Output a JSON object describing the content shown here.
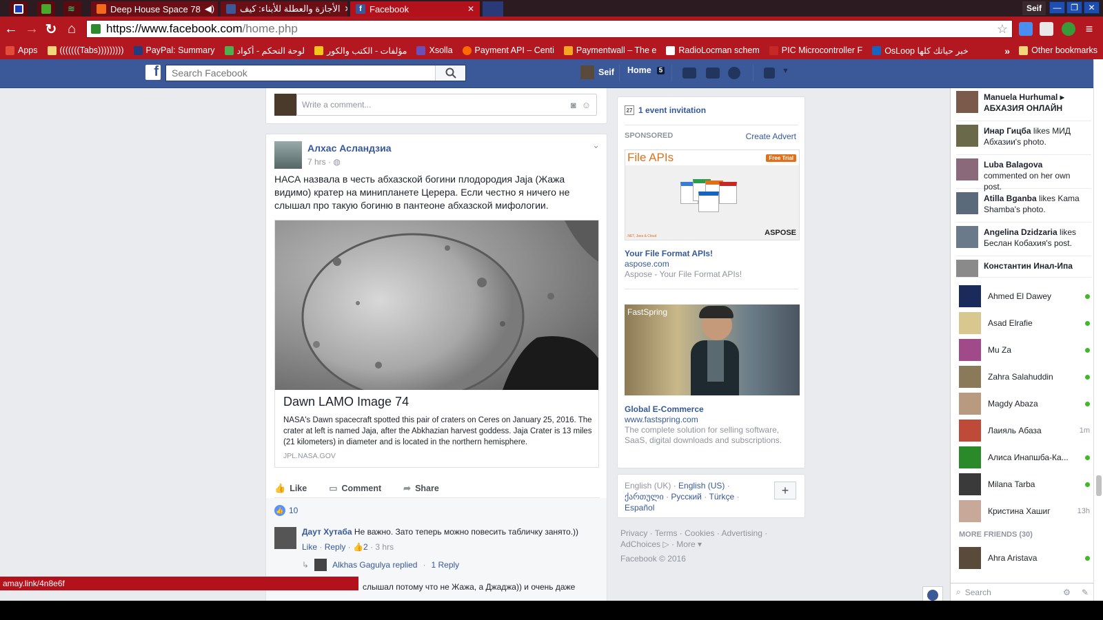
{
  "browser": {
    "tabs": [
      {
        "title": "",
        "favicon_color": "#1c3bb0"
      },
      {
        "title": "",
        "favicon_color": "#4aa82a"
      },
      {
        "title": "",
        "favicon_color": "#35a0e0"
      },
      {
        "title": "Deep House Space 78",
        "favicon_color": "#f26b1d"
      },
      {
        "title": "الأجازة والعطلة للأبناء: كيف",
        "favicon_color": "#3b5998"
      },
      {
        "title": "Facebook",
        "favicon_color": "#3b5998"
      }
    ],
    "profile_name": "Seif",
    "url_host": "https://www.facebook.com",
    "url_path": "/home.php",
    "bookmarks": [
      {
        "label": "Apps",
        "color": "#e34b3b"
      },
      {
        "label": "(((((((Tabs)))))))))",
        "color": "#f2d67a"
      },
      {
        "label": "PayPal: Summary",
        "color": "#253b80"
      },
      {
        "label": "لوحة التحكم - أكواد",
        "color": "#4caf50"
      },
      {
        "label": "مؤلفات - الكتب والكور",
        "color": "#f5c518"
      },
      {
        "label": "Xsolla",
        "color": "#6b4fbb"
      },
      {
        "label": "Payment API – Centi",
        "color": "#ff6a00"
      },
      {
        "label": "Paymentwall – The e",
        "color": "#f5a623"
      },
      {
        "label": "RadioLocman schem",
        "color": "#ffffff"
      },
      {
        "label": "PIC Microcontroller F",
        "color": "#c62828"
      },
      {
        "label": "OsLoop خبر حياتك كلها",
        "color": "#1565c0"
      }
    ],
    "more_label": "»",
    "other_bookmarks": "Other bookmarks",
    "status_url": "amay.link/4n8e6f"
  },
  "fb": {
    "search_placeholder": "Search Facebook",
    "user": "Seif",
    "home_label": "Home",
    "home_count": "5"
  },
  "comment_box": {
    "placeholder": "Write a comment..."
  },
  "post": {
    "author": "Алхас Асландзиа",
    "time": "7 hrs ·",
    "text": "НАСА назвала в честь абхазской богини плодородия Jaja (Жажа видимо) кратер на минипланете Церера. Если честно я ничего не слышал про такую богиню в пантеоне абхазской мифологии.",
    "link": {
      "title": "Dawn LAMO Image 74",
      "description": "NASA's Dawn spacecraft spotted this pair of craters on Ceres on January 25, 2016. The crater at left is named Jaja, after the Abkhazian harvest goddess. Jaja Crater is 13 miles (21 kilometers) in diameter and is located in the northern hemisphere.",
      "domain": "JPL.NASA.GOV"
    },
    "actions": {
      "like": "Like",
      "comment": "Comment",
      "share": "Share"
    },
    "likes_count": "10",
    "comment": {
      "author": "Даут Хутаба",
      "text": "Не важно. Зато теперь можно повесить табличку занято.))",
      "like": "Like",
      "reply": "Reply",
      "likes": "2",
      "time": "3 hrs"
    },
    "reply_summary": {
      "author": "Alkhas Gagulya replied",
      "count": "1 Reply"
    },
    "comment2_fragment": "слышал потому что не Жажа, а Джаджа)) и очень даже"
  },
  "right": {
    "event": "1 event invitation",
    "event_icon_text": "27",
    "sponsored": "SPONSORED",
    "create_advert": "Create Advert",
    "ads": [
      {
        "title": "Your File Format APIs!",
        "url": "aspose.com",
        "desc": "Aspose - Your File Format APIs!",
        "banner_title": "File APIs",
        "banner_badge": "Free Trial",
        "banner_brand": "ASPOSE",
        "banner_small": ".NET, Java & Cloud"
      },
      {
        "title": "Global E-Commerce",
        "url": "www.fastspring.com",
        "desc": "The complete solution for selling software, SaaS, digital downloads and subscriptions.",
        "banner_brand": "FastSpring"
      }
    ],
    "languages": {
      "current": "English (UK)",
      "others": [
        "English (US)",
        "ქართული",
        "Русский",
        "Türkçe",
        "Español"
      ]
    },
    "footer_links": [
      "Privacy",
      "Terms",
      "Cookies",
      "Advertising",
      "AdChoices",
      "More"
    ],
    "copyright": "Facebook © 2016"
  },
  "ticker": [
    {
      "name": "Manuela Hurhumal",
      "text": "▸ АБХАЗИЯ ОНЛАЙН",
      "bold_text": true
    },
    {
      "name": "Инар Гицба",
      "text": "likes МИД Абхазии's photo."
    },
    {
      "name": "Luba Balagova",
      "text": "commented on her own post."
    },
    {
      "name": "Atilla Bganba",
      "text": "likes Kama Shamba's photo."
    },
    {
      "name": "Angelina Dzidzaria",
      "text": "likes Беслан Кобахия's post."
    },
    {
      "name": "Константин Инал-Ипа",
      "text": ""
    }
  ],
  "chat": {
    "friends": [
      {
        "name": "Ahmed El Dawey",
        "status": "online"
      },
      {
        "name": "Asad Elrafie",
        "status": "online"
      },
      {
        "name": "Mu Za",
        "status": "online"
      },
      {
        "name": "Zahra Salahuddin",
        "status": "online"
      },
      {
        "name": "Magdy Abaza",
        "status": "online"
      },
      {
        "name": "Лаияль Абаза",
        "status": "1m"
      },
      {
        "name": "Алиса Инапшба-Ка...",
        "status": "online"
      },
      {
        "name": "Milana Tarba",
        "status": "online"
      },
      {
        "name": "Кристина Хашиг",
        "status": "13h"
      }
    ],
    "more_friends": "MORE FRIENDS (30)",
    "more_list": [
      {
        "name": "Ahra Aristava",
        "status": "online"
      }
    ],
    "search_placeholder": "Search"
  },
  "colors": {
    "chrome": "#b31820",
    "fb_blue": "#3b5998",
    "link": "#365899",
    "online": "#42b72a"
  }
}
